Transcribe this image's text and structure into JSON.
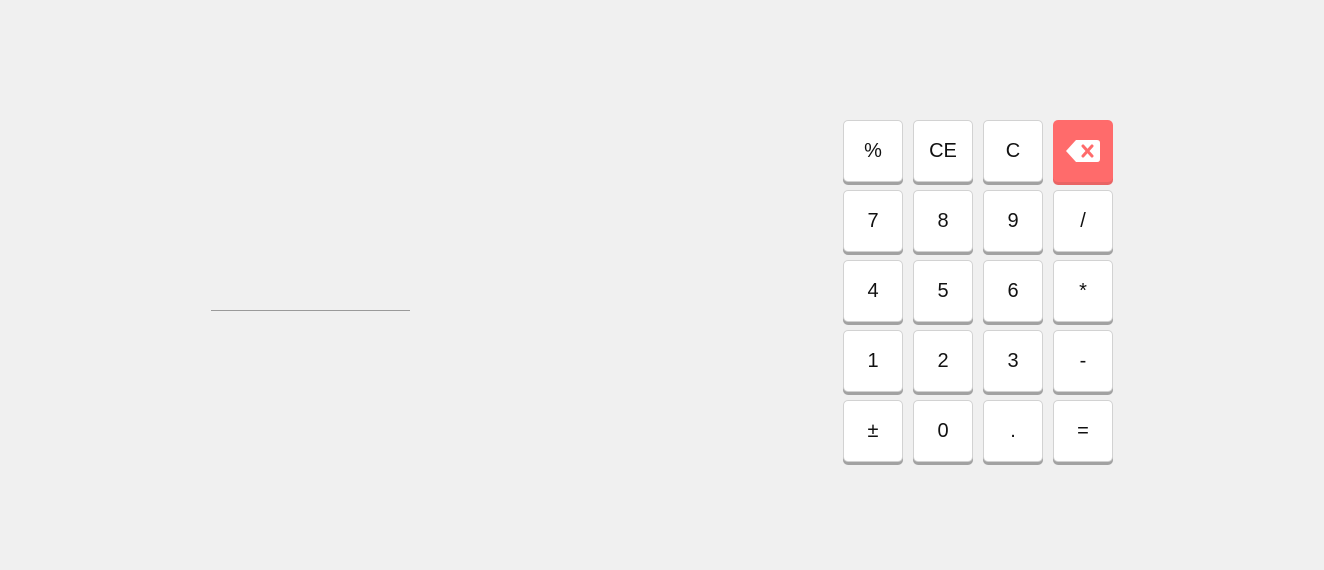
{
  "display": {
    "value": ""
  },
  "keypad": {
    "keys": [
      {
        "id": "percent",
        "label": "%"
      },
      {
        "id": "clear-entry",
        "label": "CE"
      },
      {
        "id": "clear",
        "label": "C"
      },
      {
        "id": "backspace",
        "label": "",
        "icon": "backspace-icon",
        "color": "#ff6b6b"
      },
      {
        "id": "7",
        "label": "7"
      },
      {
        "id": "8",
        "label": "8"
      },
      {
        "id": "9",
        "label": "9"
      },
      {
        "id": "divide",
        "label": "/"
      },
      {
        "id": "4",
        "label": "4"
      },
      {
        "id": "5",
        "label": "5"
      },
      {
        "id": "6",
        "label": "6"
      },
      {
        "id": "multiply",
        "label": "*"
      },
      {
        "id": "1",
        "label": "1"
      },
      {
        "id": "2",
        "label": "2"
      },
      {
        "id": "3",
        "label": "3"
      },
      {
        "id": "subtract",
        "label": "-"
      },
      {
        "id": "plus-minus",
        "label": "±"
      },
      {
        "id": "0",
        "label": "0"
      },
      {
        "id": "decimal",
        "label": "."
      },
      {
        "id": "equals",
        "label": "="
      }
    ]
  }
}
